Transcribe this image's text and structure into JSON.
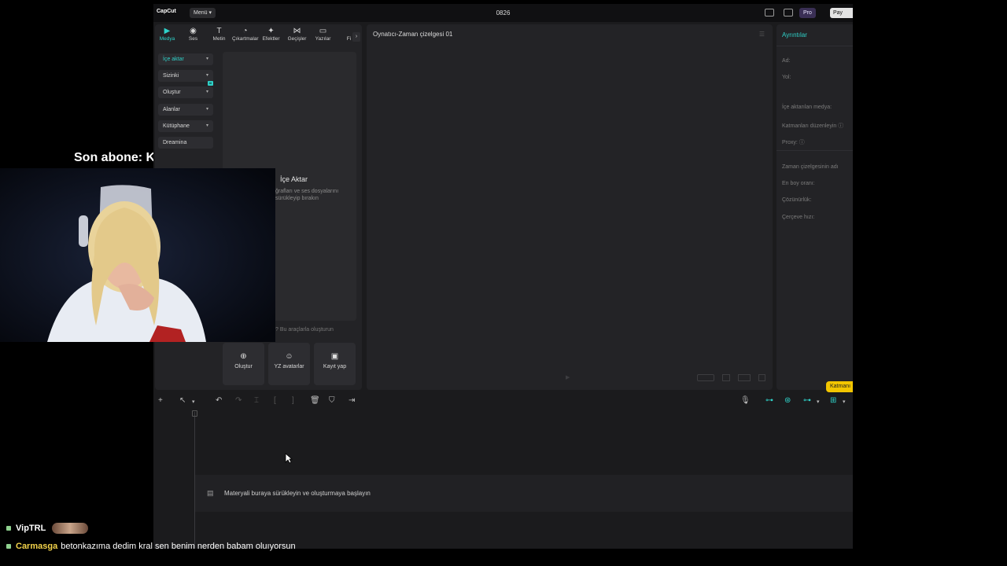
{
  "overlay": {
    "subscriber_text": "Son abone: KristoQ",
    "chat": [
      {
        "user": "VipTRL",
        "message": ""
      },
      {
        "user": "Carmasga",
        "message": "betonkazıma dedim kral sen benim nerden babam oluıyorsun"
      }
    ]
  },
  "app": {
    "logo": "CapCut",
    "menu_label": "Menü ▾",
    "project_title": "0826",
    "pro_label": "Pro",
    "pay_label": "Pay"
  },
  "left_panel": {
    "tabs": [
      {
        "label": "Medya",
        "icon": "media-icon",
        "glyph": "▶"
      },
      {
        "label": "Ses",
        "icon": "audio-icon",
        "glyph": "◉"
      },
      {
        "label": "Metin",
        "icon": "text-icon",
        "glyph": "T"
      },
      {
        "label": "Çıkartmalar",
        "icon": "sticker-icon",
        "glyph": "◔"
      },
      {
        "label": "Efektler",
        "icon": "effects-icon",
        "glyph": "✦"
      },
      {
        "label": "Geçişler",
        "icon": "transitions-icon",
        "glyph": "⋈"
      },
      {
        "label": "Yazılar",
        "icon": "captions-icon",
        "glyph": "▭"
      },
      {
        "label": "Fi",
        "icon": "filter-icon",
        "glyph": ""
      }
    ],
    "side_buttons": [
      "İçe aktar",
      "Sizinki",
      "Oluştur",
      "Alanlar",
      "Kütüphane",
      "Dreamina"
    ],
    "ai_badge": "AI",
    "import_title": "İçe Aktar",
    "import_subtitle": "ğrafları ve ses dosyalarını sürükleyip bırakın",
    "tools_label": "? Bu araçlarla oluşturun",
    "tool_cards": [
      {
        "label": "Oluştur",
        "icon": "create-icon",
        "glyph": "⊕"
      },
      {
        "label": "YZ avatarlar",
        "icon": "ai-avatar-icon",
        "glyph": "☺"
      },
      {
        "label": "Kayıt yap",
        "icon": "record-icon",
        "glyph": "▣"
      }
    ]
  },
  "player": {
    "title": "Oynatıcı-Zaman çizelgesi 01",
    "menu_glyph": "☰",
    "play_glyph": "▶"
  },
  "details": {
    "title": "Ayrıntılar",
    "fields": [
      "Ad:",
      "Yol:",
      "İçe aktarılan medya:",
      "Katmanları düzenleyin ⓘ",
      "Proxy: ⓘ",
      "Zaman çizelgesinin adı",
      "En boy oranı:",
      "Çözünürlük:",
      "Çerçeve hızı:"
    ],
    "katman_label": "Katmanı"
  },
  "timeline": {
    "drop_text": "Materyali buraya sürükleyin ve oluşturmaya başlayın",
    "film_glyph": "▤"
  }
}
